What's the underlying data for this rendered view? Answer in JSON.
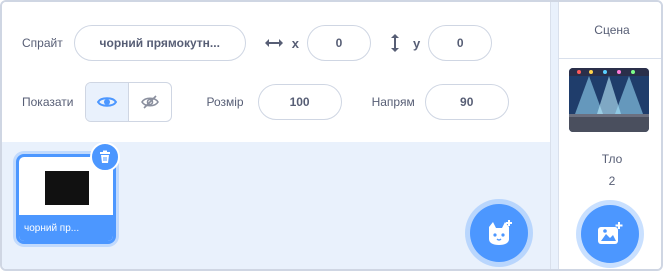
{
  "sprite_info": {
    "sprite_label": "Спрайт",
    "sprite_name": "чорний прямокутн...",
    "x_label": "x",
    "x_value": "0",
    "y_label": "y",
    "y_value": "0",
    "show_label": "Показати",
    "size_label": "Розмір",
    "size_value": "100",
    "direction_label": "Напрям",
    "direction_value": "90"
  },
  "sprite_list": {
    "sprites": [
      {
        "label": "чорний пр...",
        "selected": true
      }
    ]
  },
  "stage_pane": {
    "header": "Сцена",
    "backdrops_label": "Тло",
    "backdrops_count": "2"
  },
  "colors": {
    "accent": "#4c97ff",
    "pane_background": "#e9f1fc",
    "text": "#575e75"
  },
  "icons": [
    "arrows-horizontal-icon",
    "arrows-vertical-icon",
    "eye-icon",
    "eye-hidden-icon",
    "trash-icon",
    "choose-sprite-icon",
    "choose-backdrop-icon"
  ]
}
